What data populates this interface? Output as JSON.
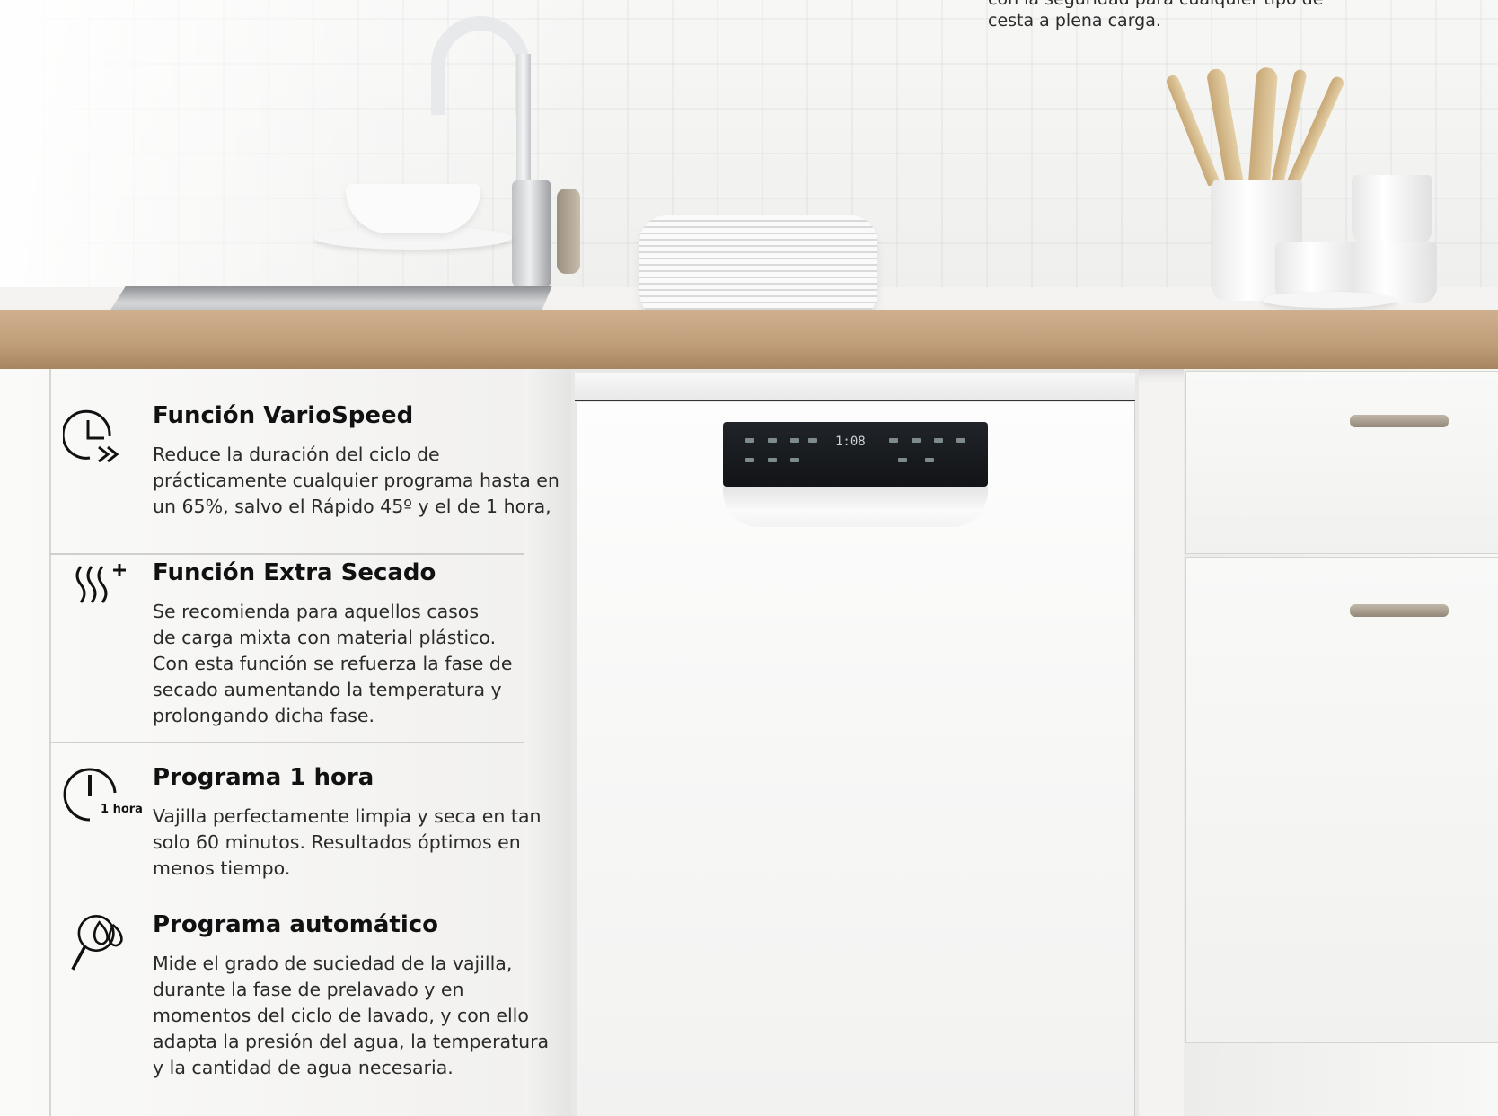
{
  "top_note": {
    "line1": "con la seguridad para cualquier tipo de",
    "line2": "cesta a plena carga."
  },
  "features": [
    {
      "icon": "variospeed-clock-icon",
      "title": "Función VarioSpeed",
      "lines": [
        "Reduce la duración del ciclo de",
        "prácticamente cualquier programa hasta en",
        "un 65%, salvo el Rápido 45º y el de 1 hora,"
      ]
    },
    {
      "icon": "extra-dry-heat-icon",
      "title": "Función Extra Secado",
      "lines": [
        "Se recomienda para aquellos casos",
        "de carga mixta con material plástico.",
        "Con esta función se refuerza la fase de",
        "secado aumentando la temperatura y",
        "prolongando dicha fase."
      ]
    },
    {
      "icon": "one-hour-timer-icon",
      "icon_label": "1 hora",
      "title": "Programa 1 hora",
      "lines": [
        "Vajilla perfectamente limpia y seca en tan",
        "solo 60 minutos. Resultados óptimos en",
        "menos tiempo."
      ]
    },
    {
      "icon": "auto-program-sensor-icon",
      "title": "Programa automático",
      "lines": [
        "Mide el grado de suciedad de la vajilla,",
        "durante la fase de prelavado y en",
        "momentos del ciclo de lavado, y con ello",
        "adapta la presión del agua, la temperatura",
        "y la cantidad de agua necesaria."
      ]
    }
  ],
  "dishwasher": {
    "display": "1:08"
  }
}
